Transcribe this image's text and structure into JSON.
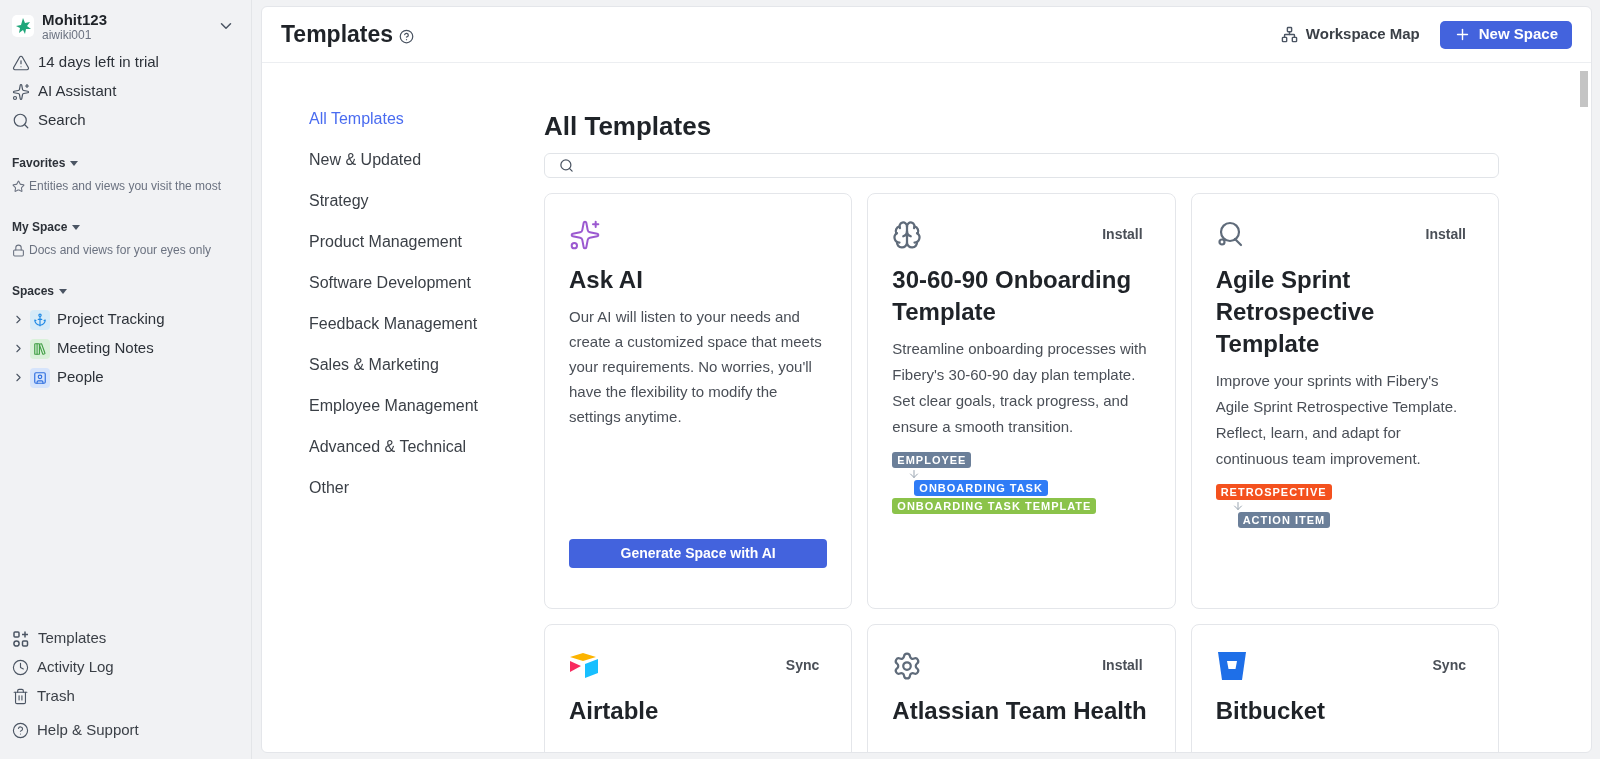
{
  "workspace": {
    "name": "Mohit123",
    "subtitle": "aiwiki001"
  },
  "sidebar": {
    "top_items": [
      {
        "label": "14 days left in trial"
      },
      {
        "label": "AI Assistant"
      },
      {
        "label": "Search"
      }
    ],
    "sections": [
      {
        "title": "Favorites",
        "hint": "Entities and views you visit the most"
      },
      {
        "title": "My Space",
        "hint": "Docs and views for your eyes only"
      },
      {
        "title": "Spaces",
        "items": [
          {
            "label": "Project Tracking",
            "expanded": false
          },
          {
            "label": "Meeting Notes",
            "expanded": false
          },
          {
            "label": "People",
            "expanded": false
          }
        ]
      }
    ],
    "bottom_items": [
      {
        "label": "Templates"
      },
      {
        "label": "Activity Log"
      },
      {
        "label": "Trash"
      },
      {
        "label": "Help & Support"
      }
    ]
  },
  "header": {
    "title": "Templates",
    "buttons": [
      {
        "kind": "link",
        "label": "Workspace Map"
      },
      {
        "kind": "primary",
        "label": "New Space"
      }
    ]
  },
  "categories": [
    {
      "label": "All Templates",
      "selected": true
    },
    {
      "label": "New & Updated",
      "selected": false
    },
    {
      "label": "Strategy",
      "selected": false
    },
    {
      "label": "Product Management",
      "selected": false
    },
    {
      "label": "Software Development",
      "selected": false
    },
    {
      "label": "Feedback Management",
      "selected": false
    },
    {
      "label": "Sales & Marketing",
      "selected": false
    },
    {
      "label": "Employee Management",
      "selected": false
    },
    {
      "label": "Advanced & Technical",
      "selected": false
    },
    {
      "label": "Other",
      "selected": false
    }
  ],
  "content": {
    "heading": "All Templates",
    "cards": [
      {
        "kind": "ai",
        "title": "Ask AI",
        "description": "Our AI will listen to your needs and create a customized space that meets your requirements. No worries, you'll have the flexibility to modify the settings anytime.",
        "button": "Generate Space with AI"
      },
      {
        "kind": "template",
        "action": "Install",
        "title": "30-60-90 Onboarding Template",
        "description": "Streamline onboarding processes with Fibery's 30-60-90 day plan template. Set clear goals, track progress, and ensure a smooth transition.",
        "diagram": [
          {
            "label": "EMPLOYEE",
            "color": "#6b7f99",
            "children": [
              {
                "label": "ONBOARDING TASK",
                "color": "#2f7cf6"
              }
            ]
          },
          {
            "label": "ONBOARDING TASK TEMPLATE",
            "color": "#8bc34a"
          }
        ]
      },
      {
        "kind": "template",
        "action": "Install",
        "title": "Agile Sprint Retrospective Template",
        "description": "Improve your sprints with Fibery's Agile Sprint Retrospective Template. Reflect, learn, and adapt for continuous team improvement.",
        "diagram": [
          {
            "label": "RETROSPECTIVE",
            "color": "#f4511e",
            "children": [
              {
                "label": "ACTION ITEM",
                "color": "#6b7f99"
              }
            ]
          }
        ]
      },
      {
        "kind": "template",
        "action": "Sync",
        "title": "Airtable"
      },
      {
        "kind": "template",
        "action": "Install",
        "title": "Atlassian Team Health"
      },
      {
        "kind": "template",
        "action": "Sync",
        "title": "Bitbucket"
      }
    ]
  }
}
